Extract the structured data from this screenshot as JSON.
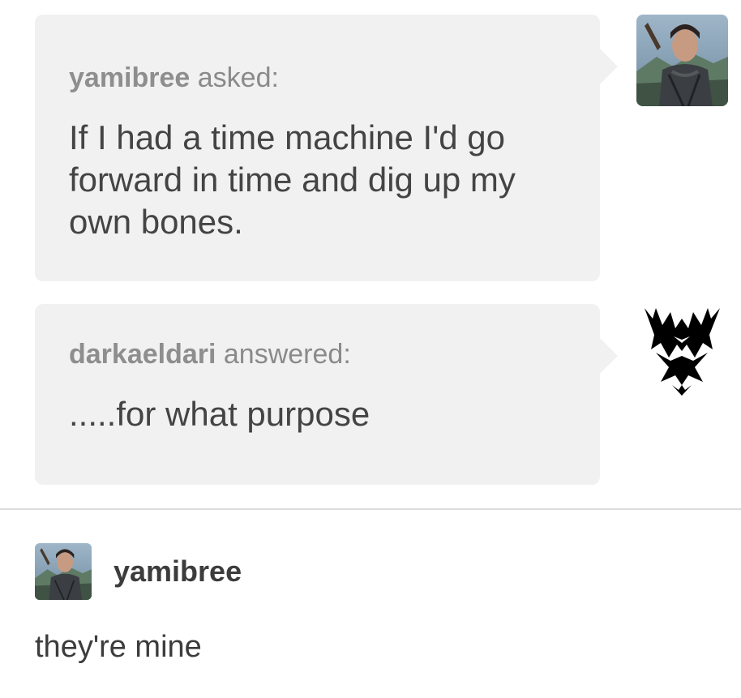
{
  "ask": {
    "username": "yamibree",
    "action": " asked:",
    "text": "If I had a time machine I'd go forward in time and dig up my own bones."
  },
  "answer": {
    "username": "darkaeldari",
    "action": " answered:",
    "text": ".....for what purpose"
  },
  "reply": {
    "username": "yamibree",
    "text": "they're mine"
  },
  "colors": {
    "bubble_bg": "#f1f1f1",
    "header_gray": "#8a8a8a",
    "body_text": "#444444",
    "divider": "#dcdcdc"
  },
  "icons": {
    "asker_avatar": "portrait-avatar-icon",
    "answerer_avatar": "black-tribal-symbol-icon",
    "reply_avatar": "portrait-avatar-icon"
  }
}
